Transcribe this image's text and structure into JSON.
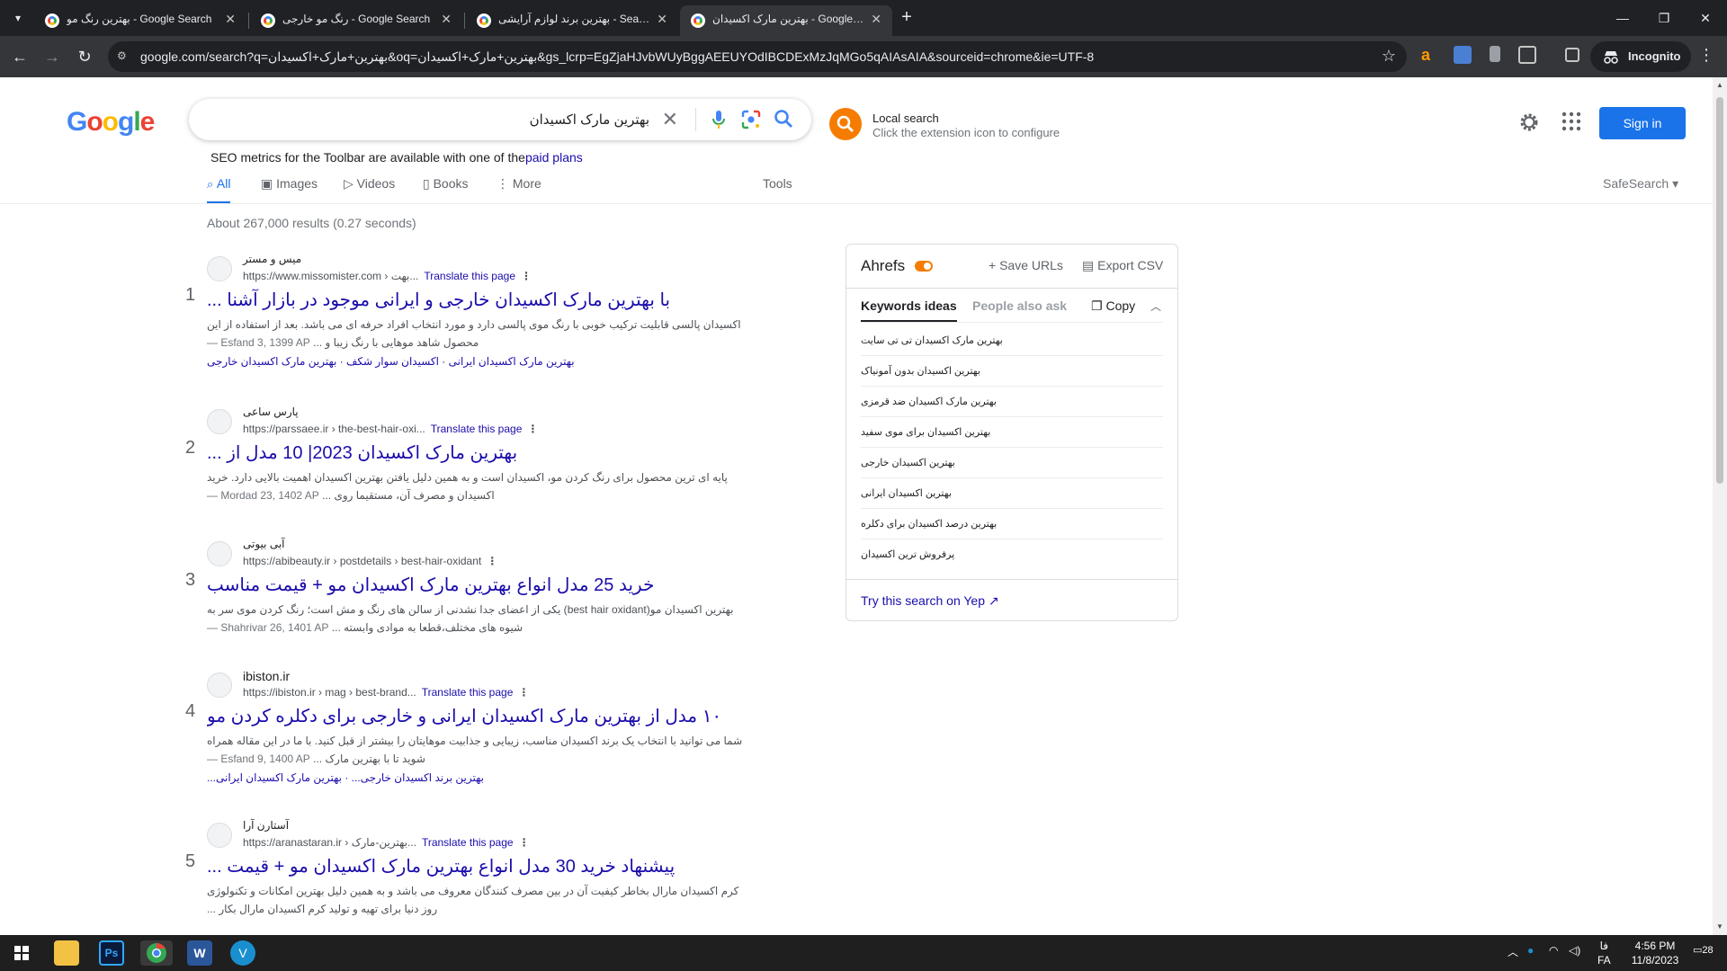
{
  "browser": {
    "tabs": [
      {
        "title": "بهترین رنگ مو - Google Search",
        "active": false
      },
      {
        "title": "رنگ مو خارجی - Google Search",
        "active": false
      },
      {
        "title": "بهترین برند لوازم آرایشی - Search",
        "active": false
      },
      {
        "title": "بهترین مارک اکسیدان - Google Search",
        "active": true
      }
    ],
    "url": "google.com/search?q=بهترین+مارک+اکسیدان&oq=بهترین+مارک+اکسیدان&gs_lcrp=EgZjaHJvbWUyBggAEEUYOdIBCDExMzJqMGo5qAIAsAIA&sourceid=chrome&ie=UTF-8",
    "incognito_label": "Incognito"
  },
  "google": {
    "query": "بهترین مارک اکسیدان",
    "local_search": {
      "title": "Local search",
      "subtitle": "Click the extension icon to configure"
    },
    "signin": "Sign in",
    "seo_note": "SEO metrics for the Toolbar are available with one of the",
    "seo_link": "paid plans",
    "tabs": [
      "All",
      "Images",
      "Videos",
      "Books",
      "More",
      "Tools"
    ],
    "safesearch": "SafeSearch",
    "stats": "About 267,000 results (0.27 seconds)"
  },
  "results": [
    {
      "num": "1",
      "site": "میس و مستر",
      "cite": "https://www.missomister.com › بهت...",
      "translate": "Translate this page",
      "title": "با بهترین مارک اکسیدان خارجی و ایرانی موجود در بازار آشنا ...",
      "date": "Esfand 3, 1399 AP —",
      "snippet": "اکسیدان پالسی قابلیت ترکیب خوبی با رنگ موی پالسی دارد و مورد انتخاب افراد حرفه ای می باشد. بعد از استفاده از این محصول شاهد موهایی با رنگ زیبا و ...",
      "links": "بهترین مارک اکسیدان ایرانی · اکسیدان سوار شکف · بهترین مارک اکسیدان خارجی"
    },
    {
      "num": "2",
      "site": "پارس ساعی",
      "cite": "https://parssaee.ir › the-best-hair-oxi...",
      "translate": "Translate this page",
      "title": "بهترین مارک اکسیدان 2023| 10 مدل از ...",
      "date": "Mordad 23, 1402 AP —",
      "snippet": "پایه ای ترین محصول برای رنگ کردن مو، اکسیدان است و به همین دلیل یافتن بهترین اکسیدان اهمیت بالایی دارد. خرید اکسیدان و مصرف آن، مستقیما روی ...",
      "links": ""
    },
    {
      "num": "3",
      "site": "آبی بیوتی",
      "cite": "https://abibeauty.ir › postdetails › best-hair-oxidant",
      "translate": "",
      "title": "خرید 25 مدل انواع بهترین مارک اکسیدان مو + قیمت مناسب",
      "date": "Shahrivar 26, 1401 AP —",
      "snippet": "بهترین اکسیدان مو(best hair oxidant) یکی از اعضای جدا نشدنی از سالن های رنگ و مش است؛ رنگ کردن موی سر به شیوه های مختلف،قطعا به موادی وابسته ...",
      "links": ""
    },
    {
      "num": "4",
      "site": "ibiston.ir",
      "cite": "https://ibiston.ir › mag › best-brand...",
      "translate": "Translate this page",
      "title": "۱۰ مدل از بهترین مارک اکسیدان ایرانی و خارجی برای دکلره کردن مو",
      "date": "Esfand 9, 1400 AP —",
      "snippet": "شما می توانید با انتخاب یک برند اکسیدان مناسب، زیبایی و جذابیت موهایتان را بیشتر از قبل کنید. با ما در این مقاله همراه شوید تا با بهترین مارک ...",
      "links": "بهترین برند اکسیدان خارجی... · بهترین مارک اکسیدان ایرانی..."
    },
    {
      "num": "5",
      "site": "آستارن آرا",
      "cite": "https://aranastaran.ir › بهترین-مارک...",
      "translate": "Translate this page",
      "title": "پیشنهاد خرید 30 مدل انواع بهترین مارک اکسیدان مو + قیمت ...",
      "date": "",
      "snippet": "کرم اکسیدان مارال بخاطر کیفیت آن در بین مصرف کنندگان معروف می باشد و به همین دلیل بهترین امکانات و تکنولوژی روز دنیا برای تهیه و تولید کرم اکسیدان مارال بکار ...",
      "links": ""
    }
  ],
  "ahrefs": {
    "brand": "Ahrefs",
    "save_urls": "Save URLs",
    "export_csv": "Export CSV",
    "tab_keywords": "Keywords ideas",
    "tab_people": "People also ask",
    "copy": "Copy",
    "keywords": [
      "بهترین مارک اکسیدان تی تی سایت",
      "بهترین اکسیدان بدون آمونیاک",
      "بهترین مارک اکسیدان ضد قرمزی",
      "بهترین اکسیدان برای موی سفید",
      "بهترین اکسیدان خارجی",
      "بهترین اکسیدان ایرانی",
      "بهترین درصد اکسیدان برای دکلره",
      "پرفروش ترین اکسیدان"
    ],
    "try_yep": "Try this search on Yep"
  },
  "taskbar": {
    "time": "4:56 PM",
    "date": "11/8/2023",
    "lang_top": "فا",
    "lang_bottom": "FA",
    "notif_count": "28"
  }
}
